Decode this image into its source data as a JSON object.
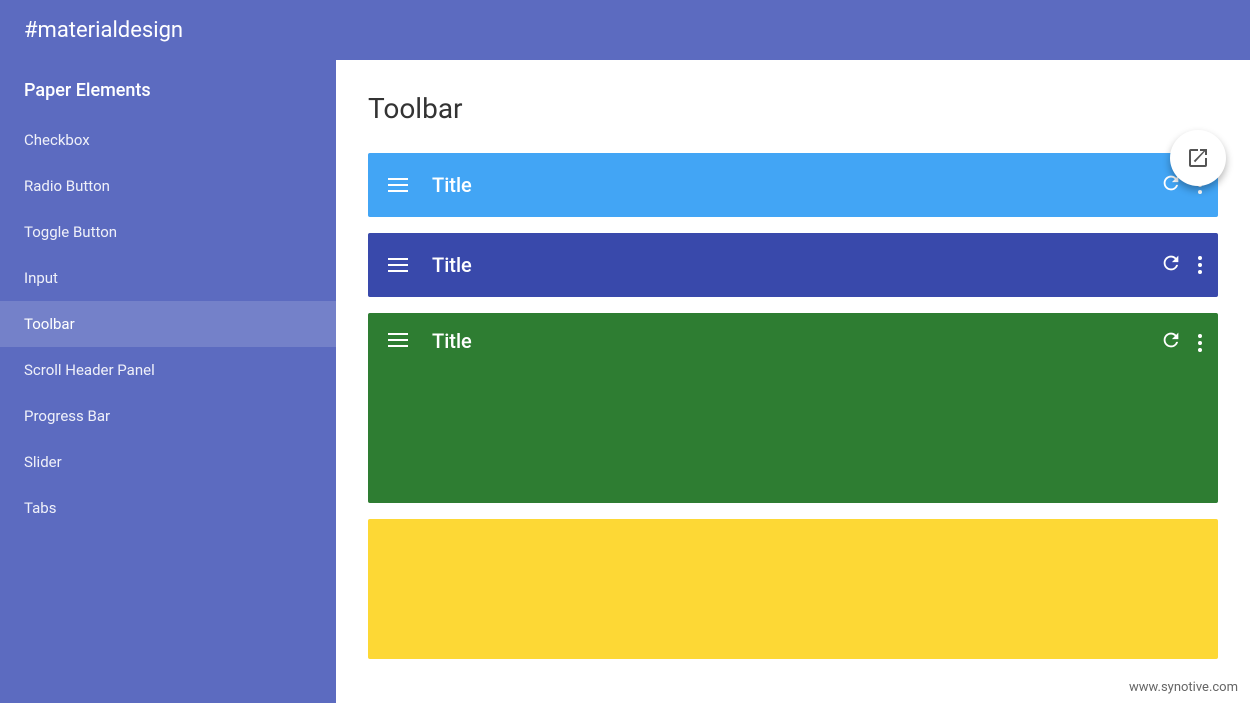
{
  "header": {
    "title": "#materialdesign",
    "background": "#5c6bc0"
  },
  "sidebar": {
    "title": "Paper Elements",
    "items": [
      {
        "label": "Checkbox",
        "active": false
      },
      {
        "label": "Radio Button",
        "active": false
      },
      {
        "label": "Toggle Button",
        "active": false
      },
      {
        "label": "Input",
        "active": false
      },
      {
        "label": "Toolbar",
        "active": true
      },
      {
        "label": "Scroll Header Panel",
        "active": false
      },
      {
        "label": "Progress Bar",
        "active": false
      },
      {
        "label": "Slider",
        "active": false
      },
      {
        "label": "Tabs",
        "active": false
      }
    ]
  },
  "content": {
    "title": "Toolbar",
    "toolbars": [
      {
        "id": "blue",
        "color": "#42a5f5",
        "title": "Title"
      },
      {
        "id": "indigo",
        "color": "#3949ab",
        "title": "Title"
      },
      {
        "id": "green",
        "color": "#2e7d32",
        "title": "Title"
      },
      {
        "id": "yellow",
        "color": "#fdd835",
        "title": ""
      }
    ]
  },
  "fab": {
    "label": "open-in-new"
  },
  "footer": {
    "text": "www.synotive.com"
  }
}
